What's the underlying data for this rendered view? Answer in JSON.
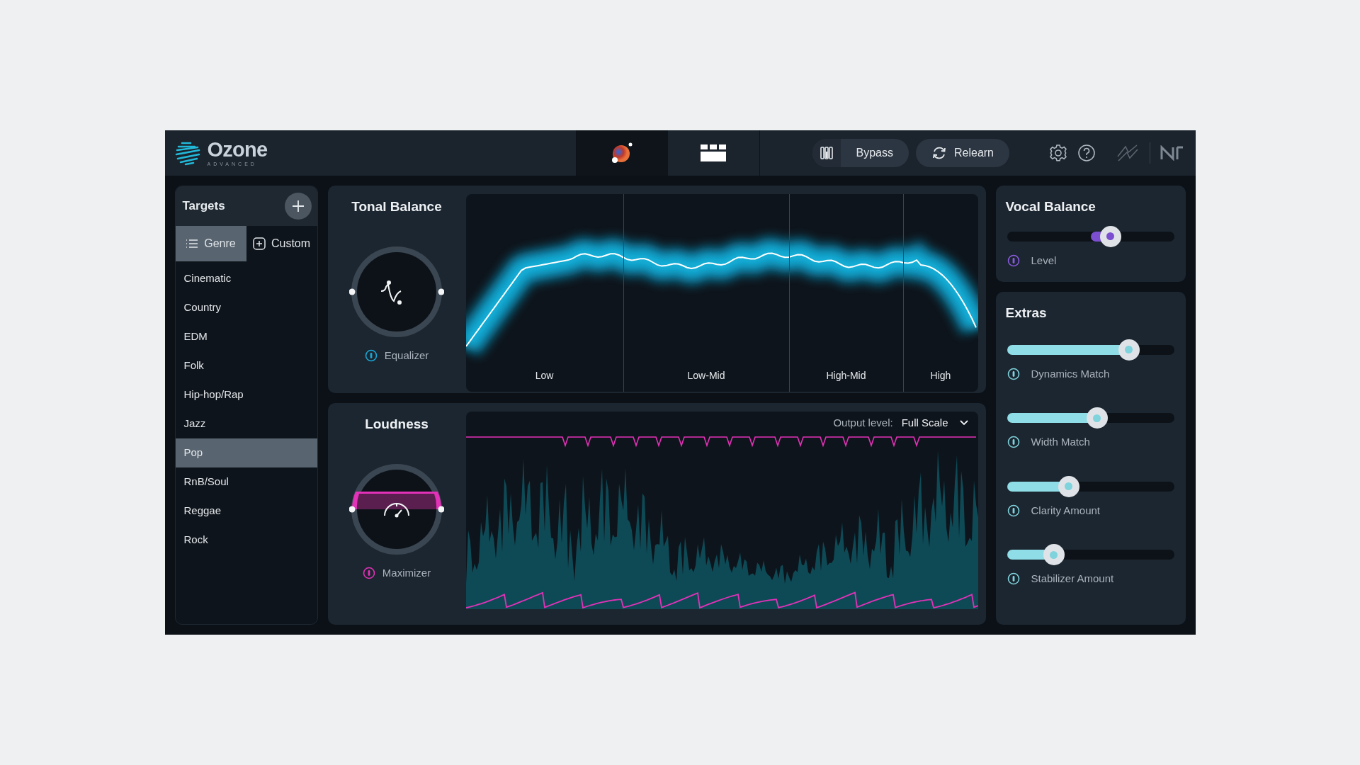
{
  "app": {
    "name": "Ozone",
    "edition": "ADVANCED"
  },
  "header_tabs": [
    {
      "kind": "assistant",
      "selected": true
    },
    {
      "kind": "modules",
      "selected": false
    }
  ],
  "header_buttons": [
    {
      "kind": "bypass",
      "label": "Bypass"
    },
    {
      "kind": "relearn",
      "label": "Relearn"
    }
  ],
  "targets": {
    "title": "Targets",
    "modes": [
      {
        "label": "Genre",
        "kind": "list",
        "selected": true
      },
      {
        "label": "Custom",
        "kind": "add",
        "selected": false
      }
    ],
    "items": [
      {
        "label": "Cinematic",
        "selected": false
      },
      {
        "label": "Country",
        "selected": false
      },
      {
        "label": "EDM",
        "selected": false
      },
      {
        "label": "Folk",
        "selected": false
      },
      {
        "label": "Hip-hop/Rap",
        "selected": false
      },
      {
        "label": "Jazz",
        "selected": false
      },
      {
        "label": "Pop",
        "selected": true
      },
      {
        "label": "RnB/Soul",
        "selected": false
      },
      {
        "label": "Reggae",
        "selected": false
      },
      {
        "label": "Rock",
        "selected": false
      }
    ]
  },
  "tonal_balance": {
    "title": "Tonal Balance",
    "module": "Equalizer",
    "bands": [
      "Low",
      "Low-Mid",
      "High-Mid",
      "High"
    ]
  },
  "loudness": {
    "title": "Loudness",
    "module": "Maximizer",
    "output_label": "Output level:",
    "output_value": "Full Scale"
  },
  "vocal_balance": {
    "title": "Vocal Balance",
    "level": 0.62,
    "label": "Level"
  },
  "extras": {
    "title": "Extras",
    "sliders": [
      {
        "label": "Dynamics Match",
        "level": 0.73
      },
      {
        "label": "Width Match",
        "level": 0.54
      },
      {
        "label": "Clarity Amount",
        "level": 0.37
      },
      {
        "label": "Stabilizer Amount",
        "level": 0.28
      }
    ]
  }
}
